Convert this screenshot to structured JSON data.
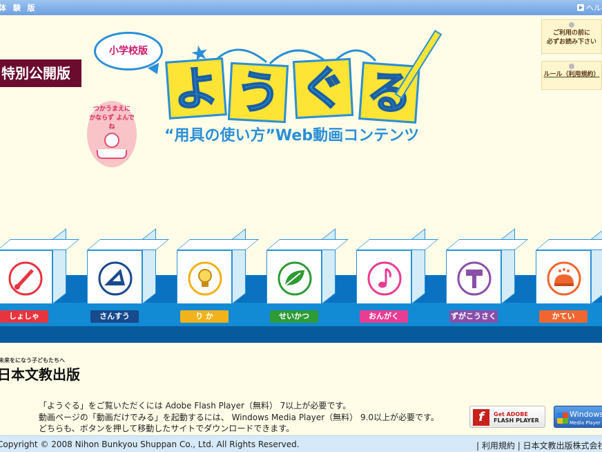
{
  "header": {
    "title": "体 験 版",
    "help_label": "ヘルプ"
  },
  "special_label": "特別公開版",
  "bubble_label": "小学校版",
  "warning": {
    "line1": "つかうまえに",
    "line2": "かならず よんでね"
  },
  "logo": {
    "chars": [
      "よ",
      "う",
      "ぐ",
      "る"
    ],
    "subtitle": "“用具の使い方”Web動画コンテンツ"
  },
  "side_buttons": [
    {
      "line1": "ご利用の前に",
      "line2": "必ずお読み下さい"
    },
    {
      "line1": "ルール（利用規約）"
    }
  ],
  "subjects": [
    {
      "label": "しょしゃ",
      "color": "#e8343e",
      "icon": "brush-icon"
    },
    {
      "label": "さんすう",
      "color": "#184a8c",
      "icon": "triangle-ruler-icon"
    },
    {
      "label": "り か",
      "color": "#f1b21a",
      "icon": "light-bulb-icon"
    },
    {
      "label": "せいかつ",
      "color": "#2f9b36",
      "icon": "leaf-icon"
    },
    {
      "label": "おんがく",
      "color": "#e83d93",
      "icon": "music-note-icon"
    },
    {
      "label": "ずがこうさく",
      "color": "#8a4fa8",
      "icon": "hammer-icon"
    },
    {
      "label": "かてい",
      "color": "#f06630",
      "icon": "pincushion-icon"
    }
  ],
  "company": {
    "tagline": "未来をになう子どもたちへ",
    "name": "日本文教出版"
  },
  "notes": [
    "「ようぐる」をご覧いただくには Adobe Flash Player（無料） 7以上が必要です。",
    "動画ページの「動画だけでみる」を起動するには、 Windows Media Player（無料） 9.0以上が必要です。",
    "どちらも、ボタンを押して移動したサイトでダウンロードできます。"
  ],
  "badges": {
    "flash_line1": "Get ADOBE",
    "flash_line2": "FLASH PLAYER",
    "wmp_line1": "Windows",
    "wmp_line2": "Media Player"
  },
  "footer": {
    "copyright": "Copyright © 2008 Nihon Bunkyou Shuppan Co., Ltd. All Rights Reserved.",
    "link1": "利用規約",
    "link2": "日本文教出版株式会社"
  }
}
